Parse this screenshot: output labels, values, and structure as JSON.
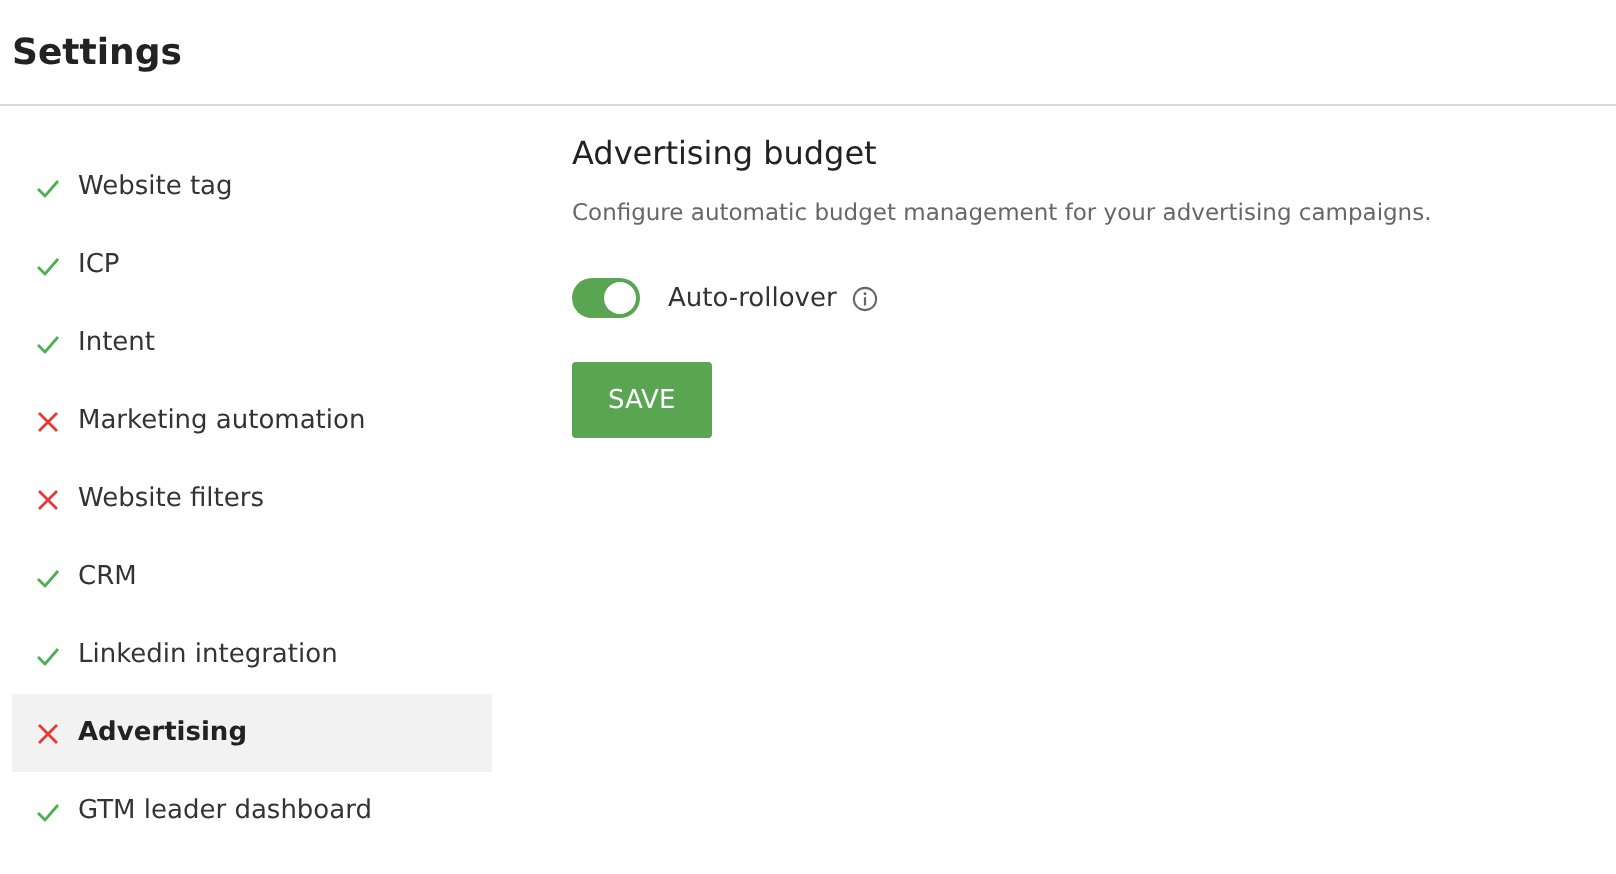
{
  "header": {
    "title": "Settings"
  },
  "sidebar": {
    "items": [
      {
        "label": "Website tag",
        "done": true,
        "selected": false
      },
      {
        "label": "ICP",
        "done": true,
        "selected": false
      },
      {
        "label": "Intent",
        "done": true,
        "selected": false
      },
      {
        "label": "Marketing automation",
        "done": false,
        "selected": false
      },
      {
        "label": "Website filters",
        "done": false,
        "selected": false
      },
      {
        "label": "CRM",
        "done": true,
        "selected": false
      },
      {
        "label": "Linkedin integration",
        "done": true,
        "selected": false
      },
      {
        "label": "Advertising",
        "done": false,
        "selected": true
      },
      {
        "label": "GTM leader dashboard",
        "done": true,
        "selected": false
      }
    ]
  },
  "section": {
    "title": "Advertising budget",
    "description": "Configure automatic budget management for your advertising campaigns.",
    "toggle": {
      "label": "Auto-rollover",
      "on": true
    },
    "save_button": "SAVE"
  }
}
